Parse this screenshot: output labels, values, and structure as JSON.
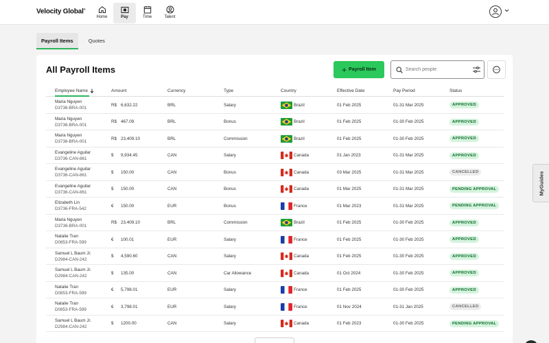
{
  "header": {
    "logo": "Velocity Global",
    "logo_mark": "®",
    "nav": [
      {
        "label": "Home",
        "icon": "home-icon"
      },
      {
        "label": "Pay",
        "icon": "pay-icon",
        "active": true
      },
      {
        "label": "Time",
        "icon": "calendar-icon"
      },
      {
        "label": "Talent",
        "icon": "talent-icon"
      }
    ]
  },
  "tabs": [
    {
      "label": "Payroll Items",
      "active": true
    },
    {
      "label": "Quotes",
      "active": false
    }
  ],
  "main": {
    "title": "All Payroll Items",
    "add_button": "Payroll Item",
    "search_placeholder": "Search people"
  },
  "table": {
    "columns": [
      "Employee Name",
      "Amount",
      "Currency",
      "Type",
      "Country",
      "Effective Date",
      "Pay Period",
      "Status"
    ],
    "rows": [
      {
        "name": "Maria Nguyen",
        "id": "D3736-BRA-001",
        "sym": "R$",
        "amount": "6,632.22",
        "currency": "BRL",
        "type": "Salary",
        "country": "Brazil",
        "flag": "br",
        "effective": "01 Feb 2025",
        "period": "01-31 Mar 2025",
        "status": "APPROVED",
        "status_kind": "approved"
      },
      {
        "name": "Maria Nguyen",
        "id": "D3736-BRA-001",
        "sym": "R$",
        "amount": "467.09",
        "currency": "BRL",
        "type": "Bonus",
        "country": "Brazil",
        "flag": "br",
        "effective": "01 Feb 2025",
        "period": "01-30 Feb 2025",
        "status": "APPROVED",
        "status_kind": "approved"
      },
      {
        "name": "Maria Nguyen",
        "id": "D3736-BRA-001",
        "sym": "R$",
        "amount": "23,409.10",
        "currency": "BRL",
        "type": "Commission",
        "country": "Brazil",
        "flag": "br",
        "effective": "01 Feb 2025",
        "period": "01-30 Feb 2025",
        "status": "APPROVED",
        "status_kind": "approved"
      },
      {
        "name": "Evangeline Aguilar",
        "id": "D3736-CAN-861",
        "sym": "$",
        "amount": "9,934.45",
        "currency": "CAN",
        "type": "Salary",
        "country": "Canada",
        "flag": "ca",
        "effective": "01 Jan 2023",
        "period": "01-31 Mar 2025",
        "status": "APPROVED",
        "status_kind": "approved"
      },
      {
        "name": "Evangeline Aguilar",
        "id": "D3736-CAN-861",
        "sym": "$",
        "amount": "150.00",
        "currency": "CAN",
        "type": "Bonus",
        "country": "Canada",
        "flag": "ca",
        "effective": "03 Mar 2025",
        "period": "01-31 Mar 2025",
        "status": "CANCELLED",
        "status_kind": "cancelled"
      },
      {
        "name": "Evangeline Aguilar",
        "id": "D3736-CAN-861",
        "sym": "$",
        "amount": "150.00",
        "currency": "CAN",
        "type": "Bonus",
        "country": "Canada",
        "flag": "ca",
        "effective": "01 Mar 2025",
        "period": "01-31 Mar 2025",
        "status": "PENDING APPROVAL",
        "status_kind": "pending"
      },
      {
        "name": "Elizabeth Lin",
        "id": "D3736-FRA-542",
        "sym": "€",
        "amount": "150.00",
        "currency": "EUR",
        "type": "Bonus",
        "country": "France",
        "flag": "fr",
        "effective": "01 Mar 2023",
        "period": "01-31 Mar 2025",
        "status": "PENDING APPROVAL",
        "status_kind": "pending"
      },
      {
        "name": "Maria Nguyen",
        "id": "D3736-BRA-001",
        "sym": "R$",
        "amount": "23,409.10",
        "currency": "BRL",
        "type": "Commission",
        "country": "Brazil",
        "flag": "br",
        "effective": "01 Feb 2025",
        "period": "01-30 Feb 2025",
        "status": "APPROVED",
        "status_kind": "approved"
      },
      {
        "name": "Natalie Tran",
        "id": "D0853-FRA-599",
        "sym": "€",
        "amount": "100.01",
        "currency": "EUR",
        "type": "Salary",
        "country": "France",
        "flag": "fr",
        "effective": "01 Feb 2025",
        "period": "01-30 Feb 2025",
        "status": "APPROVED",
        "status_kind": "approved"
      },
      {
        "name": "Samuel L Baum Jr.",
        "id": "D2984-CAN-242",
        "sym": "$",
        "amount": "4,590.60",
        "currency": "CAN",
        "type": "Salary",
        "country": "Canada",
        "flag": "ca",
        "effective": "01 Feb 2025",
        "period": "01-30 Feb 2025",
        "status": "APPROVED",
        "status_kind": "approved"
      },
      {
        "name": "Samuel L Baum Jr.",
        "id": "D2984-CAN-242",
        "sym": "$",
        "amount": "135.00",
        "currency": "CAN",
        "type": "Car Allowance",
        "country": "Canada",
        "flag": "ca",
        "effective": "01 Oct 2024",
        "period": "01-30 Feb 2025",
        "status": "APPROVED",
        "status_kind": "approved"
      },
      {
        "name": "Natalie Tran",
        "id": "D0853-FRA-599",
        "sym": "€",
        "amount": "5,798.01",
        "currency": "EUR",
        "type": "Salary",
        "country": "France",
        "flag": "fr",
        "effective": "01 Feb 2025",
        "period": "01-30 Feb 2025",
        "status": "APPROVED",
        "status_kind": "approved"
      },
      {
        "name": "Natalie Tran",
        "id": "D0853-FRA-599",
        "sym": "€",
        "amount": "3,798.01",
        "currency": "EUR",
        "type": "Salary",
        "country": "France",
        "flag": "fr",
        "effective": "01 Nov 2024",
        "period": "01-31 Jan 2025",
        "status": "CANCELLED",
        "status_kind": "cancelled"
      },
      {
        "name": "Samuel L Baum Jr.",
        "id": "D2984-CAN-242",
        "sym": "$",
        "amount": "1200.00",
        "currency": "CAN",
        "type": "Salary",
        "country": "Canada",
        "flag": "ca",
        "effective": "01 Feb 2023",
        "period": "01-30 Feb 2025",
        "status": "PENDING APPROVAL",
        "status_kind": "pending"
      }
    ]
  },
  "side_tab": "MyGuides",
  "colors": {
    "accent": "#2bc85b",
    "approved_bg": "#d5f3dd",
    "approved_text": "#0c6b2c",
    "cancelled_bg": "#ececec"
  }
}
